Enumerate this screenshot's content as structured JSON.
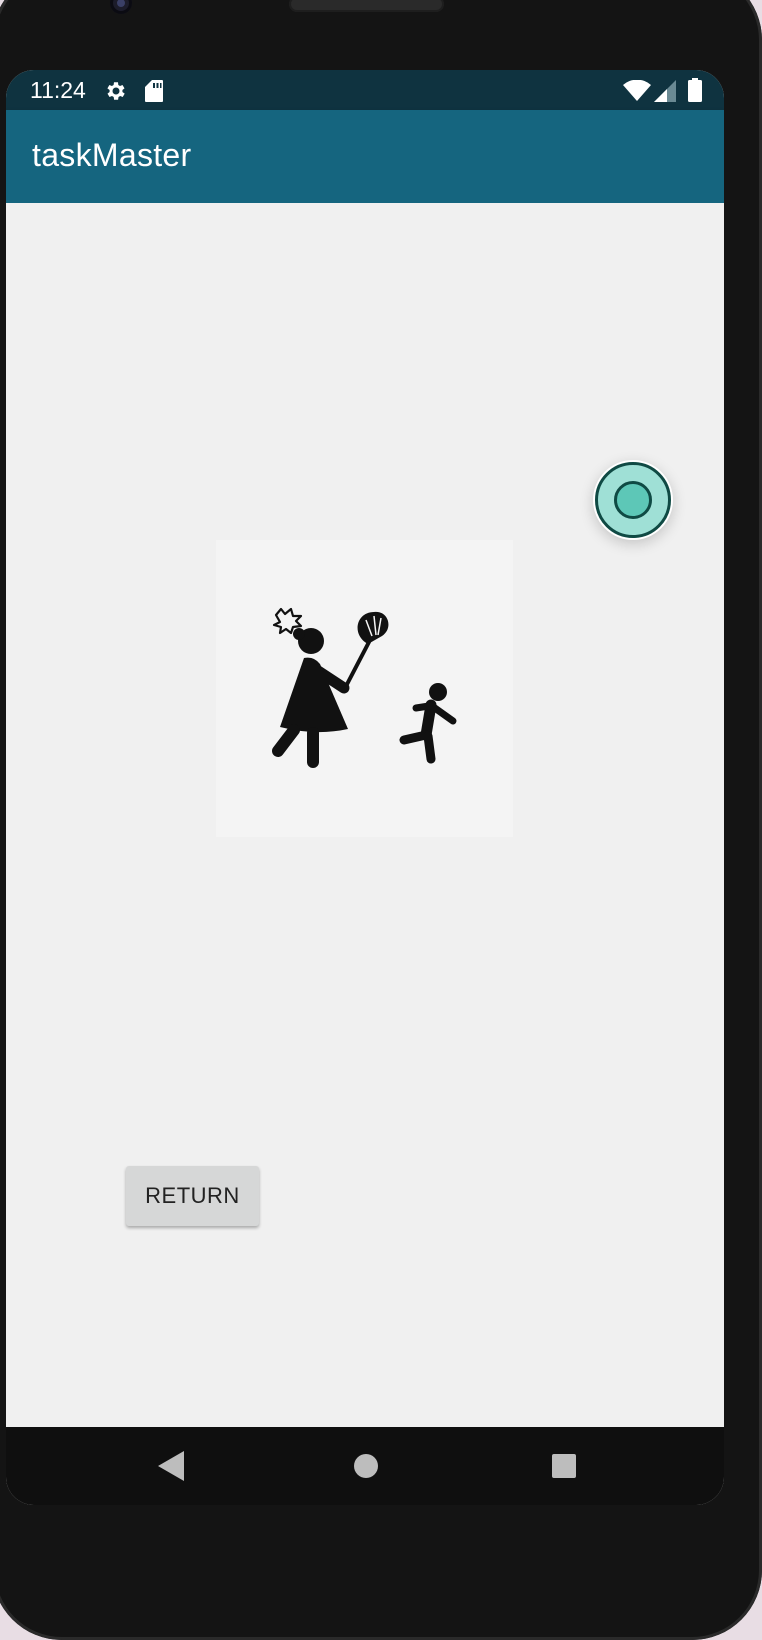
{
  "status_bar": {
    "time": "11:24",
    "icons": [
      "gear-icon",
      "sd-card-icon",
      "wifi-icon",
      "signal-icon",
      "battery-icon"
    ]
  },
  "app_bar": {
    "title": "taskMaster",
    "color": "#15657f"
  },
  "main": {
    "image": "mother-chasing-child-with-broom-illustration",
    "fab_icon": "record-icon",
    "return_label": "RETURN"
  },
  "nav_bar": {
    "icons": [
      "back-icon",
      "home-icon",
      "recents-icon"
    ]
  },
  "colors": {
    "status_bar": "#0f3340",
    "background": "#f0f0f0",
    "fab": "#5dc7b7",
    "button": "#d6d7d7"
  }
}
